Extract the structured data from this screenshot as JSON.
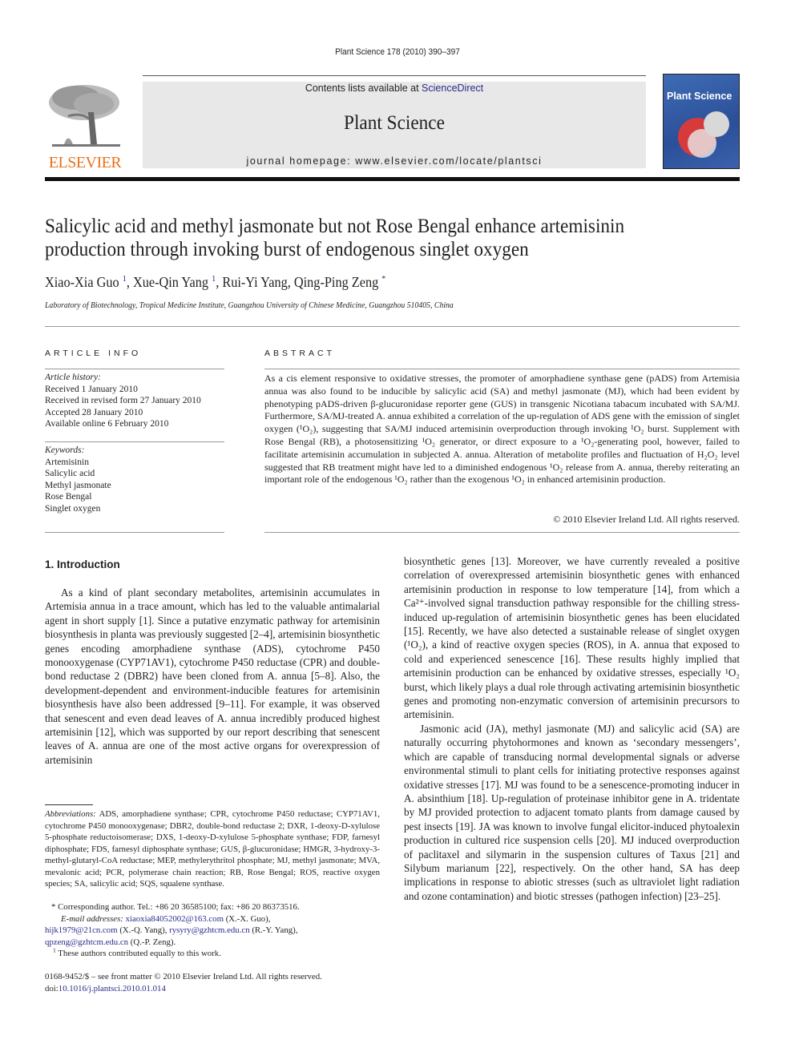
{
  "header": {
    "citation": "Plant Science 178 (2010) 390–397",
    "contents_prefix": "Contents lists available at ",
    "contents_link": "ScienceDirect",
    "journal_title": "Plant Science",
    "homepage_label": "journal homepage: www.elsevier.com/locate/plantsci",
    "publisher_logo_text": "ELSEVIER",
    "cover_title": "Plant Science"
  },
  "article": {
    "title": "Salicylic acid and methyl jasmonate but not Rose Bengal enhance artemisinin production through invoking burst of endogenous singlet oxygen",
    "authors": [
      {
        "name": "Xiao-Xia Guo",
        "mark": "1"
      },
      {
        "name": "Xue-Qin Yang",
        "mark": "1"
      },
      {
        "name": "Rui-Yi Yang",
        "mark": ""
      },
      {
        "name": "Qing-Ping Zeng",
        "mark": "*"
      }
    ],
    "affiliation": "Laboratory of Biotechnology, Tropical Medicine Institute, Guangzhou University of Chinese Medicine, Guangzhou 510405, China"
  },
  "article_info": {
    "heading": "ARTICLE INFO",
    "history_label": "Article history:",
    "history": [
      "Received 1 January 2010",
      "Received in revised form 27 January 2010",
      "Accepted 28 January 2010",
      "Available online 6 February 2010"
    ],
    "keywords_label": "Keywords:",
    "keywords": [
      "Artemisinin",
      "Salicylic acid",
      "Methyl jasmonate",
      "Rose Bengal",
      "Singlet oxygen"
    ]
  },
  "abstract": {
    "heading": "ABSTRACT",
    "text": "As a cis element responsive to oxidative stresses, the promoter of amorphadiene synthase gene (pADS) from Artemisia annua was also found to be inducible by salicylic acid (SA) and methyl jasmonate (MJ), which had been evident by phenotyping pADS-driven β-glucuronidase reporter gene (GUS) in transgenic Nicotiana tabacum incubated with SA/MJ. Furthermore, SA/MJ-treated A. annua exhibited a correlation of the up-regulation of ADS gene with the emission of singlet oxygen (¹O₂), suggesting that SA/MJ induced artemisinin overproduction through invoking ¹O₂ burst. Supplement with Rose Bengal (RB), a photosensitizing ¹O₂ generator, or direct exposure to a ¹O₂-generating pool, however, failed to facilitate artemisinin accumulation in subjected A. annua. Alteration of metabolite profiles and fluctuation of H₂O₂ level suggested that RB treatment might have led to a diminished endogenous ¹O₂ release from A. annua, thereby reiterating an important role of the endogenous ¹O₂ rather than the exogenous ¹O₂ in enhanced artemisinin production.",
    "copyright": "© 2010 Elsevier Ireland Ltd. All rights reserved."
  },
  "introduction": {
    "heading": "1.  Introduction",
    "left_column": "As a kind of plant secondary metabolites, artemisinin accumulates in Artemisia annua in a trace amount, which has led to the valuable antimalarial agent in short supply [1]. Since a putative enzymatic pathway for artemisinin biosynthesis in planta was previously suggested [2–4], artemisinin biosynthetic genes encoding amorphadiene synthase (ADS), cytochrome P450 monooxygenase (CYP71AV1), cytochrome P450 reductase (CPR) and double-bond reductase 2 (DBR2) have been cloned from A. annua [5–8]. Also, the development-dependent and environment-inducible features for artemisinin biosynthesis have also been addressed [9–11]. For example, it was observed that senescent and even dead leaves of A. annua incredibly produced highest artemisinin [12], which was supported by our report describing that senescent leaves of A. annua are one of the most active organs for overexpression of artemisinin",
    "right_column_p1": "biosynthetic genes [13]. Moreover, we have currently revealed a positive correlation of overexpressed artemisinin biosynthetic genes with enhanced artemisinin production in response to low temperature [14], from which a Ca²⁺-involved signal transduction pathway responsible for the chilling stress-induced up-regulation of artemisinin biosynthetic genes has been elucidated [15]. Recently, we have also detected a sustainable release of singlet oxygen (¹O₂), a kind of reactive oxygen species (ROS), in A. annua that exposed to cold and experienced senescence [16]. These results highly implied that artemisinin production can be enhanced by oxidative stresses, especially ¹O₂ burst, which likely plays a dual role through activating artemisinin biosynthetic genes and promoting non-enzymatic conversion of artemisinin precursors to artemisinin.",
    "right_column_p2": "Jasmonic acid (JA), methyl jasmonate (MJ) and salicylic acid (SA) are naturally occurring phytohormones and known as ‘secondary messengers’, which are capable of transducing normal developmental signals or adverse environmental stimuli to plant cells for initiating protective responses against oxidative stresses [17]. MJ was found to be a senescence-promoting inducer in A. absinthium [18]. Up-regulation of proteinase inhibitor gene in A. tridentate by MJ provided protection to adjacent tomato plants from damage caused by pest insects [19]. JA was known to involve fungal elicitor-induced phytoalexin production in cultured rice suspension cells [20]. MJ induced overproduction of paclitaxel and silymarin in the suspension cultures of Taxus [21] and Silybum marianum [22], respectively. On the other hand, SA has deep implications in response to abiotic stresses (such as ultraviolet light radiation and ozone contamination) and biotic stresses (pathogen infection) [23–25]."
  },
  "footnotes": {
    "abbreviations_label": "Abbreviations:",
    "abbreviations": "ADS, amorphadiene synthase; CPR, cytochrome P450 reductase; CYP71AV1, cytochrome P450 monooxygenase; DBR2, double-bond reductase 2; DXR, 1-deoxy-D-xylulose 5-phosphate reductoisomerase; DXS, 1-deoxy-D-xylulose 5-phosphate synthase; FDP, farnesyl diphosphate; FDS, farnesyl diphosphate synthase; GUS, β-glucuronidase; HMGR, 3-hydroxy-3-methyl-glutaryl-CoA reductase; MEP, methylerythritol phosphate; MJ, methyl jasmonate; MVA, mevalonic acid; PCR, polymerase chain reaction; RB, Rose Bengal; ROS, reactive oxygen species; SA, salicylic acid; SQS, squalene synthase.",
    "corresponding": "* Corresponding author. Tel.: +86 20 36585100; fax: +86 20 86373516.",
    "email_label": "E-mail addresses:",
    "emails": [
      {
        "address": "xiaoxia84052002@163.com",
        "owner": "(X.-X. Guo),"
      },
      {
        "address": "hijk1979@21cn.com",
        "owner": "(X.-Q. Yang),"
      },
      {
        "address": "rysyry@gzhtcm.edu.cn",
        "owner": "(R.-Y. Yang),"
      },
      {
        "address": "qpzeng@gzhtcm.edu.cn",
        "owner": "(Q.-P. Zeng)."
      }
    ],
    "equal_contribution": "These authors contributed equally to this work.",
    "equal_mark": "1",
    "front_matter": "0168-9452/$ – see front matter © 2010 Elsevier Ireland Ltd. All rights reserved.",
    "doi_prefix": "doi:",
    "doi": "10.1016/j.plantsci.2010.01.014"
  },
  "colors": {
    "link": "#2a2a8c",
    "elsevier_orange": "#e9711c",
    "banner_gray": "#e8e8e8",
    "cover_blue": "#2b4f98"
  }
}
